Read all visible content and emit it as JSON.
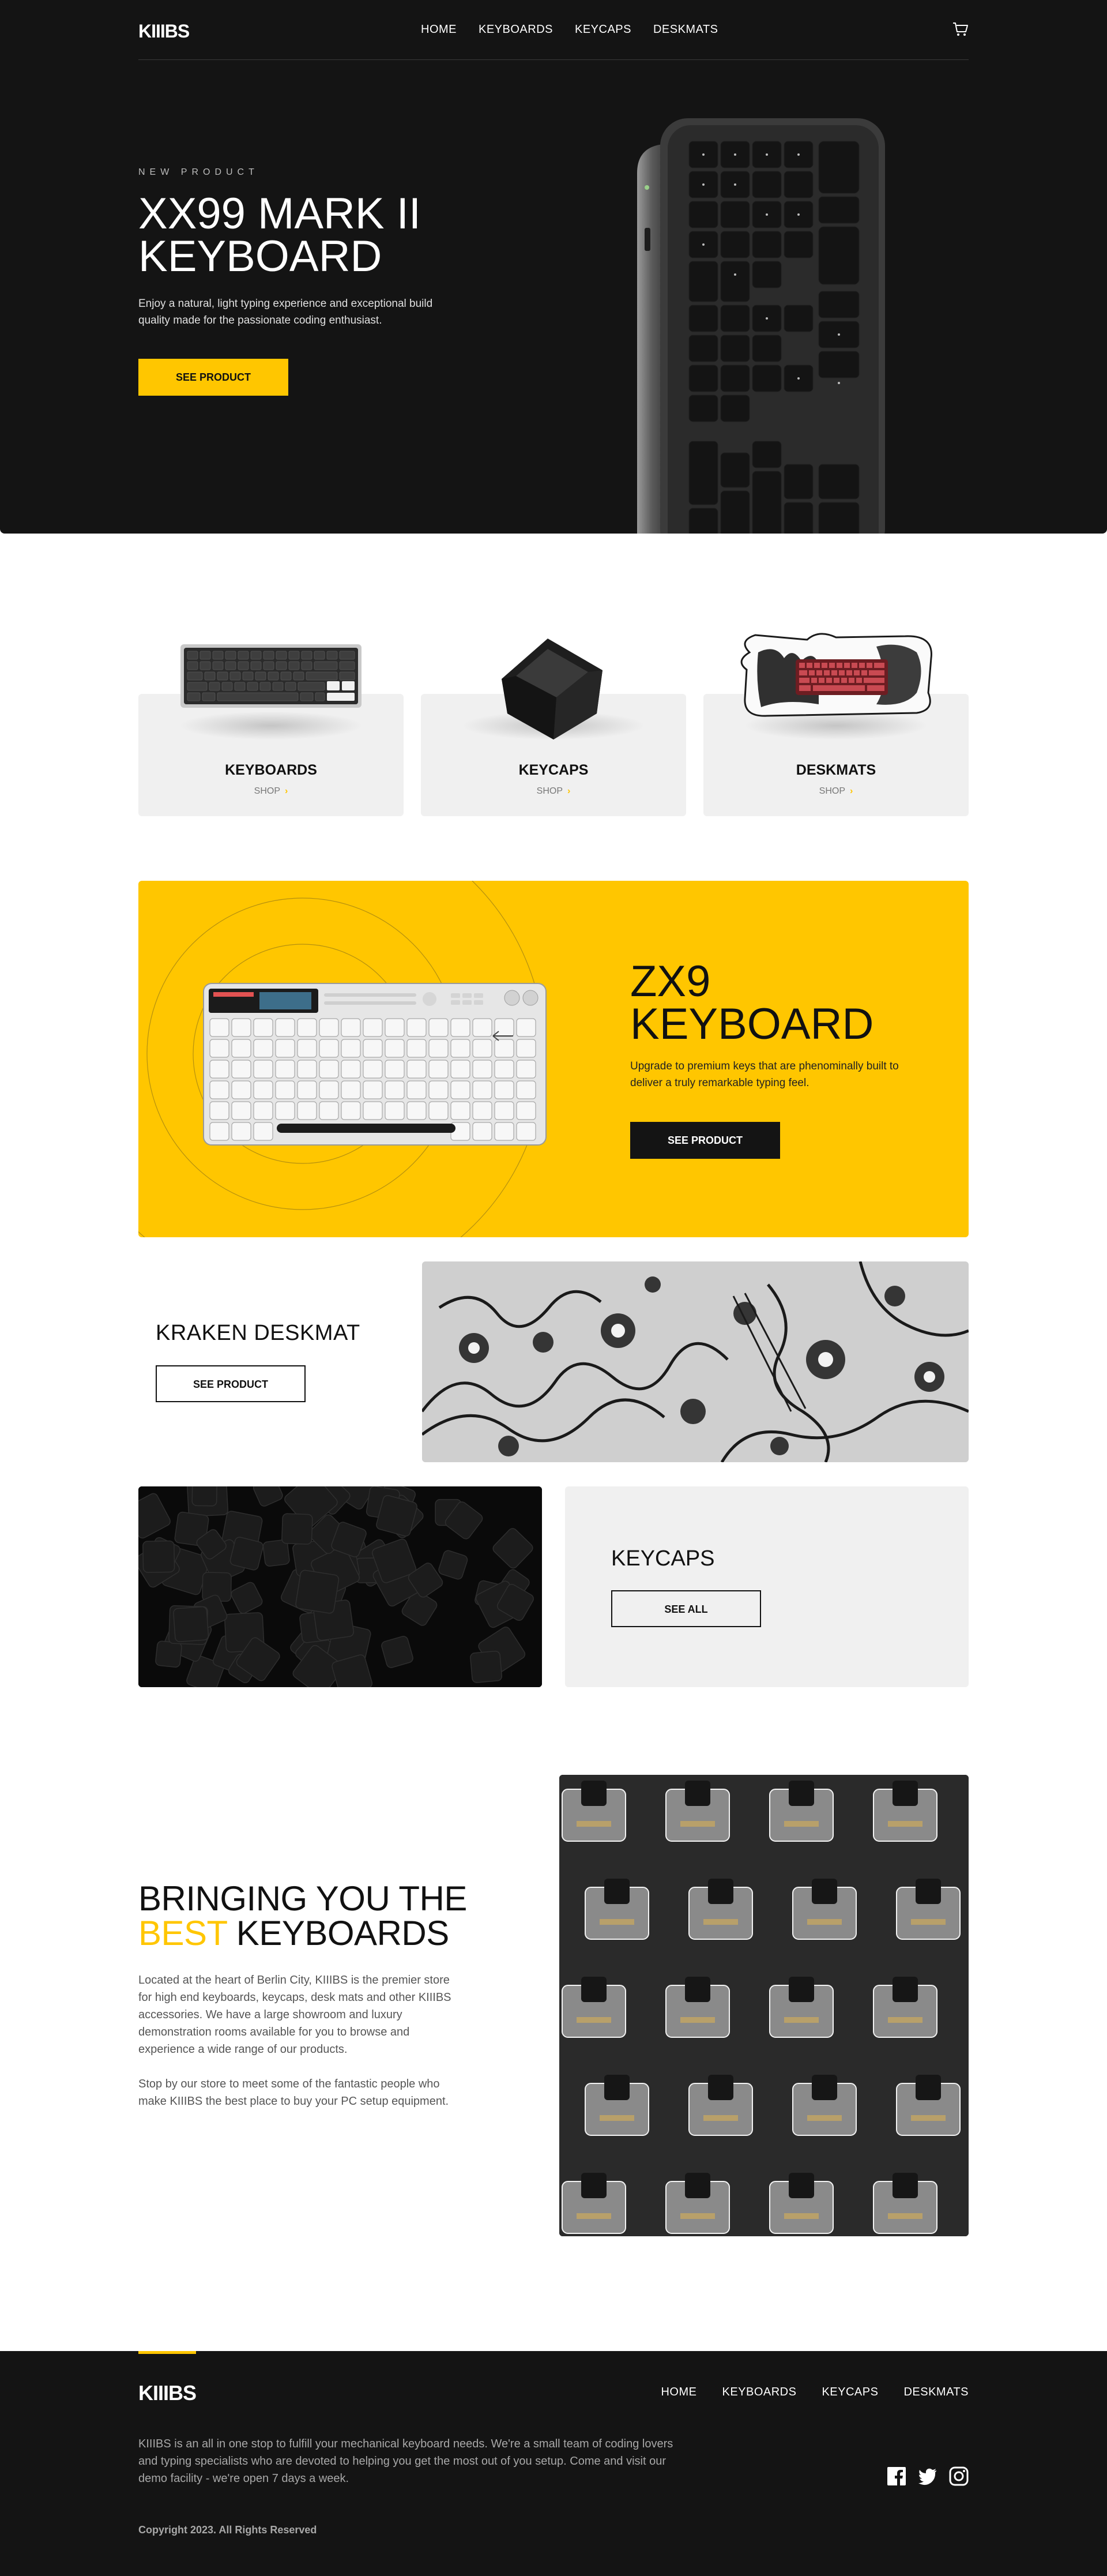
{
  "header": {
    "logo": "KIIIBS",
    "nav": [
      "HOME",
      "KEYBOARDS",
      "KEYCAPS",
      "DESKMATS"
    ],
    "cart_icon": "cart-icon"
  },
  "hero": {
    "overline": "NEW PRODUCT",
    "title_line1": "XX99 MARK II",
    "title_line2": "KEYBOARD",
    "description": "Enjoy a natural, light typing experience and exceptional build quality made for the passionate coding enthusiast.",
    "cta": "SEE PRODUCT"
  },
  "categories": [
    {
      "name": "KEYBOARDS",
      "shop": "SHOP",
      "arrow": "›"
    },
    {
      "name": "KEYCAPS",
      "shop": "SHOP",
      "arrow": "›"
    },
    {
      "name": "DESKMATS",
      "shop": "SHOP",
      "arrow": "›"
    }
  ],
  "promo": {
    "title_line1": "ZX9",
    "title_line2": "KEYBOARD",
    "description": "Upgrade to premium keys that are phenominally built to deliver a truly remarkable typing feel.",
    "cta": "SEE PRODUCT"
  },
  "kraken": {
    "title": "KRAKEN DESKMAT",
    "cta": "SEE PRODUCT"
  },
  "keycaps": {
    "title": "KEYCAPS",
    "cta": "SEE ALL"
  },
  "about": {
    "title_line1": "BRINGING YOU THE",
    "title_best": "BEST",
    "title_rest": " KEYBOARDS",
    "paragraph1": "Located at the heart of Berlin City, KIIIBS is the premier store for high end keyboards, keycaps, desk mats and other KIIIBS accessories. We have a large showroom and luxury demonstration rooms available for you to browse and experience a wide range of our products.",
    "paragraph2": "Stop by our store to meet some of the fantastic people who make KIIIBS the best place to buy your PC setup equipment."
  },
  "footer": {
    "logo": "KIIIBS",
    "nav": [
      "HOME",
      "KEYBOARDS",
      "KEYCAPS",
      "DESKMATS"
    ],
    "description": "KIIIBS is an all in one stop to fulfill your mechanical keyboard needs. We're a small team of coding lovers and typing specialists who are devoted to helping you get the most out of you setup. Come and visit our demo facility - we're open 7 days a week.",
    "copyright": "Copyright 2023. All Rights Reserved",
    "social": [
      "facebook-icon",
      "twitter-icon",
      "instagram-icon"
    ]
  },
  "colors": {
    "accent": "#ffc600",
    "dark": "#141414",
    "light_gray": "#f0f0f0"
  }
}
